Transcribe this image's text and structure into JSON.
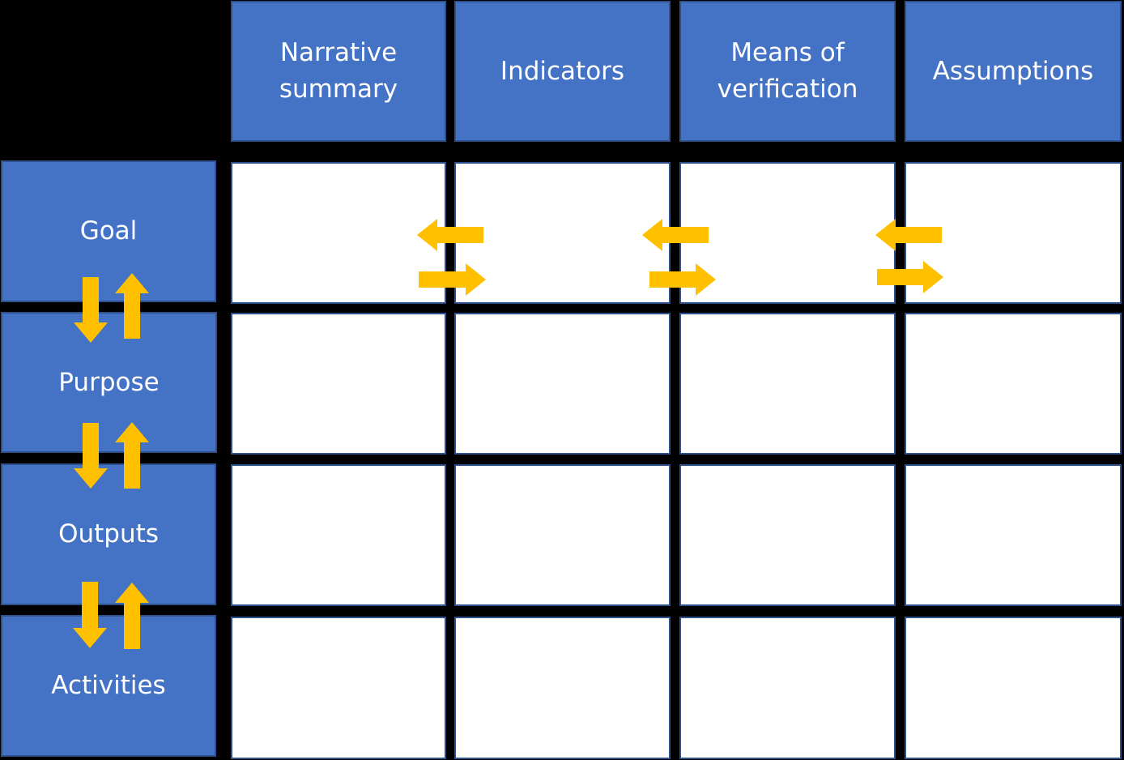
{
  "colors": {
    "header_fill": "#4472C4",
    "border": "#2F528F",
    "arrow": "#FFC000",
    "cell": "#FFFFFF",
    "background": "#000000"
  },
  "columns": [
    {
      "label": "Narrative\nsummary"
    },
    {
      "label": "Indicators"
    },
    {
      "label": "Means of\nverification"
    },
    {
      "label": "Assumptions"
    }
  ],
  "rows": [
    {
      "label": "Goal"
    },
    {
      "label": "Purpose"
    },
    {
      "label": "Outputs"
    },
    {
      "label": "Activities"
    }
  ],
  "arrows": {
    "vertical": "down-up pairs between rows",
    "horizontal": "left-right pairs between columns in Goal row"
  }
}
